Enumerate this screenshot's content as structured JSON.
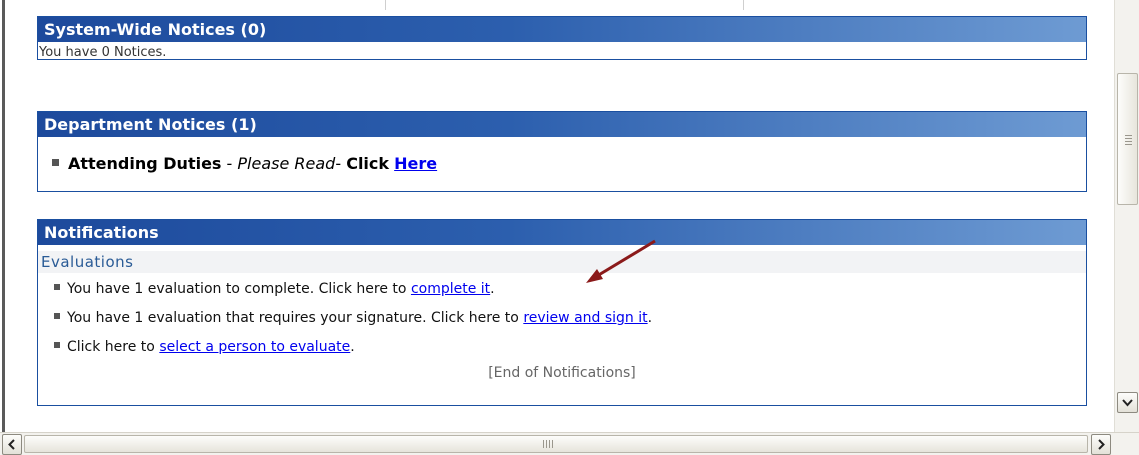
{
  "panels": {
    "system": {
      "title": "System-Wide Notices (0)",
      "message": "You have 0 Notices."
    },
    "department": {
      "title": "Department Notices (1)",
      "item_bold": "Attending Duties",
      "item_sep1": " - ",
      "item_italic": "Please Read",
      "item_sep2": "- ",
      "item_click": "Click",
      "item_link": "Here"
    },
    "notifications": {
      "title": "Notifications",
      "section_title": "Evaluations",
      "items": [
        {
          "text": "You have 1 evaluation to complete. Click here to ",
          "link": "complete it",
          "suffix": "."
        },
        {
          "text": "You have 1 evaluation that requires your signature. Click here to ",
          "link": "review and sign it",
          "suffix": "."
        },
        {
          "text": "Click here to ",
          "link": "select a person to evaluate",
          "suffix": "."
        }
      ],
      "end_note": "[End of Notifications]"
    }
  },
  "scrollbars": {
    "up_icon": "chevron-down-icon",
    "left_glyph": "<",
    "right_glyph": ">",
    "down_glyph": "v"
  },
  "colors": {
    "header_dark": "#1d4a9c",
    "header_light": "#6e9bd3",
    "link": "#0000ee",
    "section_title": "#2a5b96",
    "annotation_arrow": "#8b1a1a"
  }
}
